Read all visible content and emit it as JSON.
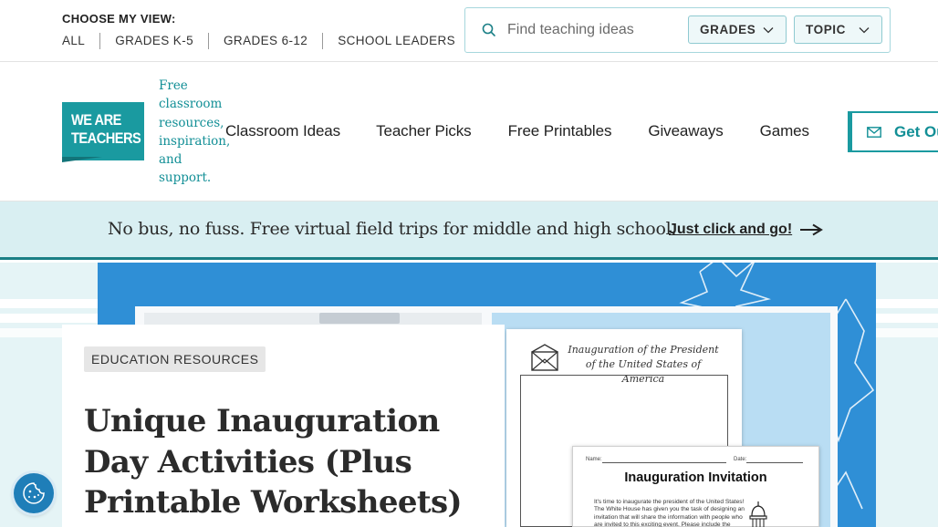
{
  "top": {
    "view_label": "CHOOSE MY VIEW:",
    "views": [
      "ALL",
      "GRADES K-5",
      "GRADES 6-12",
      "SCHOOL LEADERS"
    ],
    "search_placeholder": "Find teaching ideas",
    "grades_label": "GRADES",
    "topic_label": "TOPIC"
  },
  "brand": {
    "logo_text": "WE ARE TEACHERS",
    "tagline": "Free classroom resources, inspiration, and support.",
    "color": "#1a9aa0"
  },
  "nav": {
    "items": [
      "Classroom Ideas",
      "Teacher Picks",
      "Free Printables",
      "Giveaways",
      "Games"
    ],
    "cta_label": "Get Our"
  },
  "promo": {
    "text": "No bus, no fuss. Free virtual field trips for middle and high school.",
    "link_label": "Just click and go!"
  },
  "hero": {
    "worksheet1_title": "Inauguration of the President of the United States of America",
    "worksheet2_name_label": "Name:",
    "worksheet2_date_label": "Date:",
    "worksheet2_title": "Inauguration Invitation",
    "worksheet2_body": "It's time to inaugurate the president of the United States! The White House has given you the task of designing an invitation that will share the information with people who are invited to this exciting event. Please include the"
  },
  "article": {
    "category": "EDUCATION RESOURCES",
    "headline": "Unique Inauguration Day Activities (Plus Printable Worksheets)"
  },
  "icons": {
    "search": "search-icon",
    "chevron": "chevron-down-icon",
    "mail": "mail-icon",
    "arrow": "arrow-right-icon",
    "cookie": "cookie-icon"
  }
}
